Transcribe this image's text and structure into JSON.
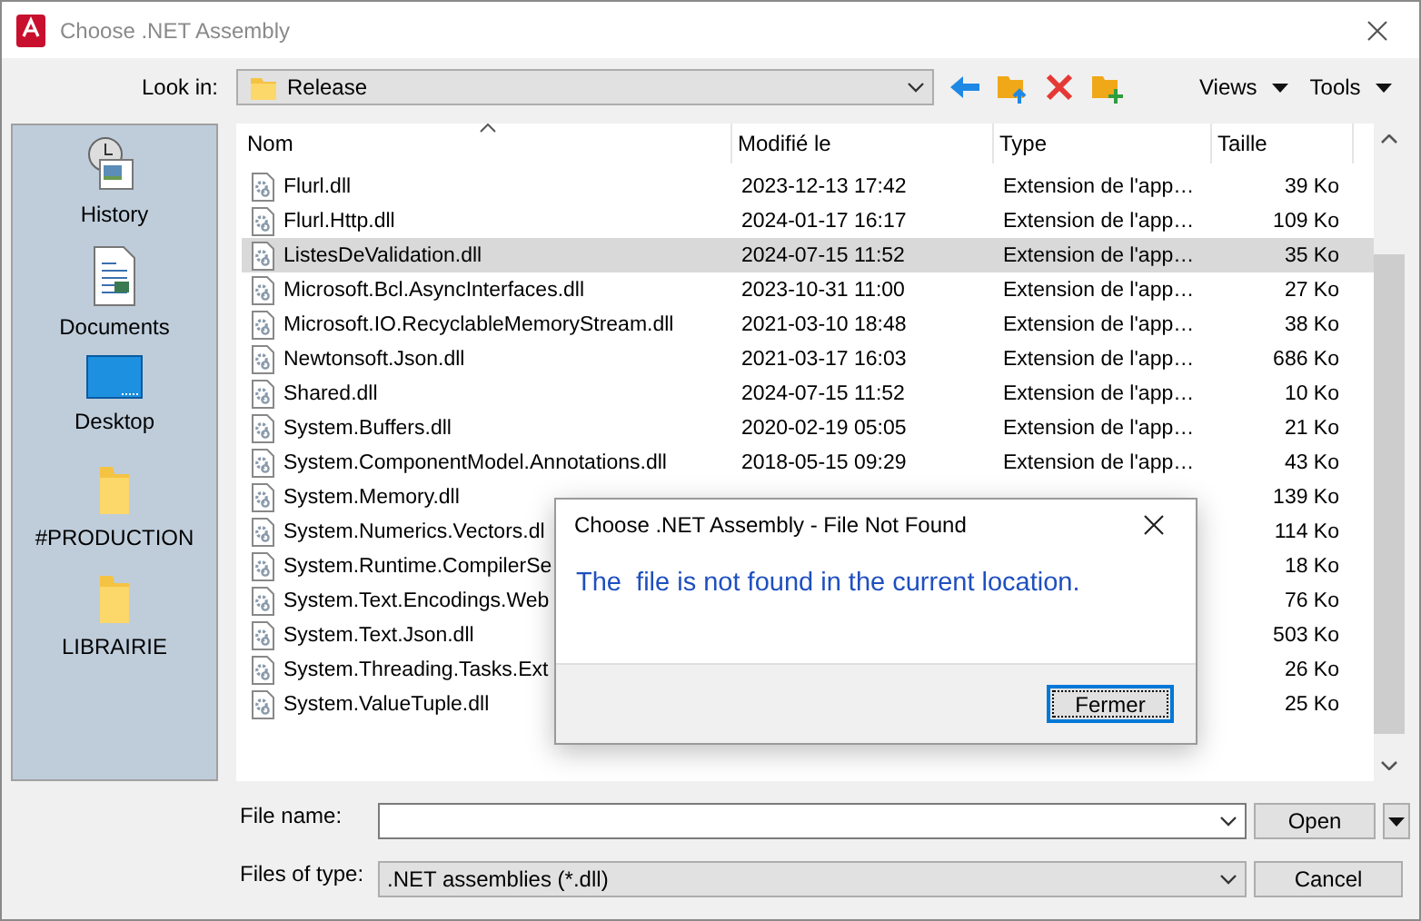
{
  "window": {
    "title": "Choose .NET Assembly"
  },
  "toolbar": {
    "look_in_label": "Look in:",
    "location": "Release",
    "views": "Views",
    "tools": "Tools"
  },
  "places": [
    {
      "label": "History",
      "kind": "history"
    },
    {
      "label": "Documents",
      "kind": "documents"
    },
    {
      "label": "Desktop",
      "kind": "desktop"
    },
    {
      "label": "#PRODUCTION",
      "kind": "folder"
    },
    {
      "label": "LIBRAIRIE",
      "kind": "folder"
    }
  ],
  "file_list": {
    "columns": [
      "Nom",
      "Modifié le",
      "Type",
      "Taille"
    ],
    "rows": [
      {
        "name": "Flurl.dll",
        "modified": "2023-12-13 17:42",
        "type": "Extension de l'app…",
        "size": "39 Ko",
        "selected": false
      },
      {
        "name": "Flurl.Http.dll",
        "modified": "2024-01-17 16:17",
        "type": "Extension de l'app…",
        "size": "109 Ko",
        "selected": false
      },
      {
        "name": "ListesDeValidation.dll",
        "modified": "2024-07-15 11:52",
        "type": "Extension de l'app…",
        "size": "35 Ko",
        "selected": true
      },
      {
        "name": "Microsoft.Bcl.AsyncInterfaces.dll",
        "modified": "2023-10-31 11:00",
        "type": "Extension de l'app…",
        "size": "27 Ko",
        "selected": false
      },
      {
        "name": "Microsoft.IO.RecyclableMemoryStream.dll",
        "modified": "2021-03-10 18:48",
        "type": "Extension de l'app…",
        "size": "38 Ko",
        "selected": false
      },
      {
        "name": "Newtonsoft.Json.dll",
        "modified": "2021-03-17 16:03",
        "type": "Extension de l'app…",
        "size": "686 Ko",
        "selected": false
      },
      {
        "name": "Shared.dll",
        "modified": "2024-07-15 11:52",
        "type": "Extension de l'app…",
        "size": "10 Ko",
        "selected": false
      },
      {
        "name": "System.Buffers.dll",
        "modified": "2020-02-19 05:05",
        "type": "Extension de l'app…",
        "size": "21 Ko",
        "selected": false
      },
      {
        "name": "System.ComponentModel.Annotations.dll",
        "modified": "2018-05-15 09:29",
        "type": "Extension de l'app…",
        "size": "43 Ko",
        "selected": false
      },
      {
        "name": "System.Memory.dll",
        "size": "139 Ko",
        "selected": false
      },
      {
        "name": "System.Numerics.Vectors.dl",
        "size": "114 Ko",
        "selected": false
      },
      {
        "name": "System.Runtime.CompilerSe",
        "size": "18 Ko",
        "selected": false
      },
      {
        "name": "System.Text.Encodings.Web",
        "size": "76 Ko",
        "selected": false
      },
      {
        "name": "System.Text.Json.dll",
        "size": "503 Ko",
        "selected": false
      },
      {
        "name": "System.Threading.Tasks.Ext",
        "size": "26 Ko",
        "selected": false
      },
      {
        "name": "System.ValueTuple.dll",
        "size": "25 Ko",
        "selected": false
      }
    ]
  },
  "file_name": {
    "label": "File name:"
  },
  "file_type": {
    "label": "Files of type:",
    "value": ".NET assemblies (*.dll)"
  },
  "buttons": {
    "open": "Open",
    "cancel": "Cancel"
  },
  "alert": {
    "title": "Choose .NET Assembly - File Not Found",
    "message": "The  file is not found in the current location.",
    "button": "Fermer"
  }
}
